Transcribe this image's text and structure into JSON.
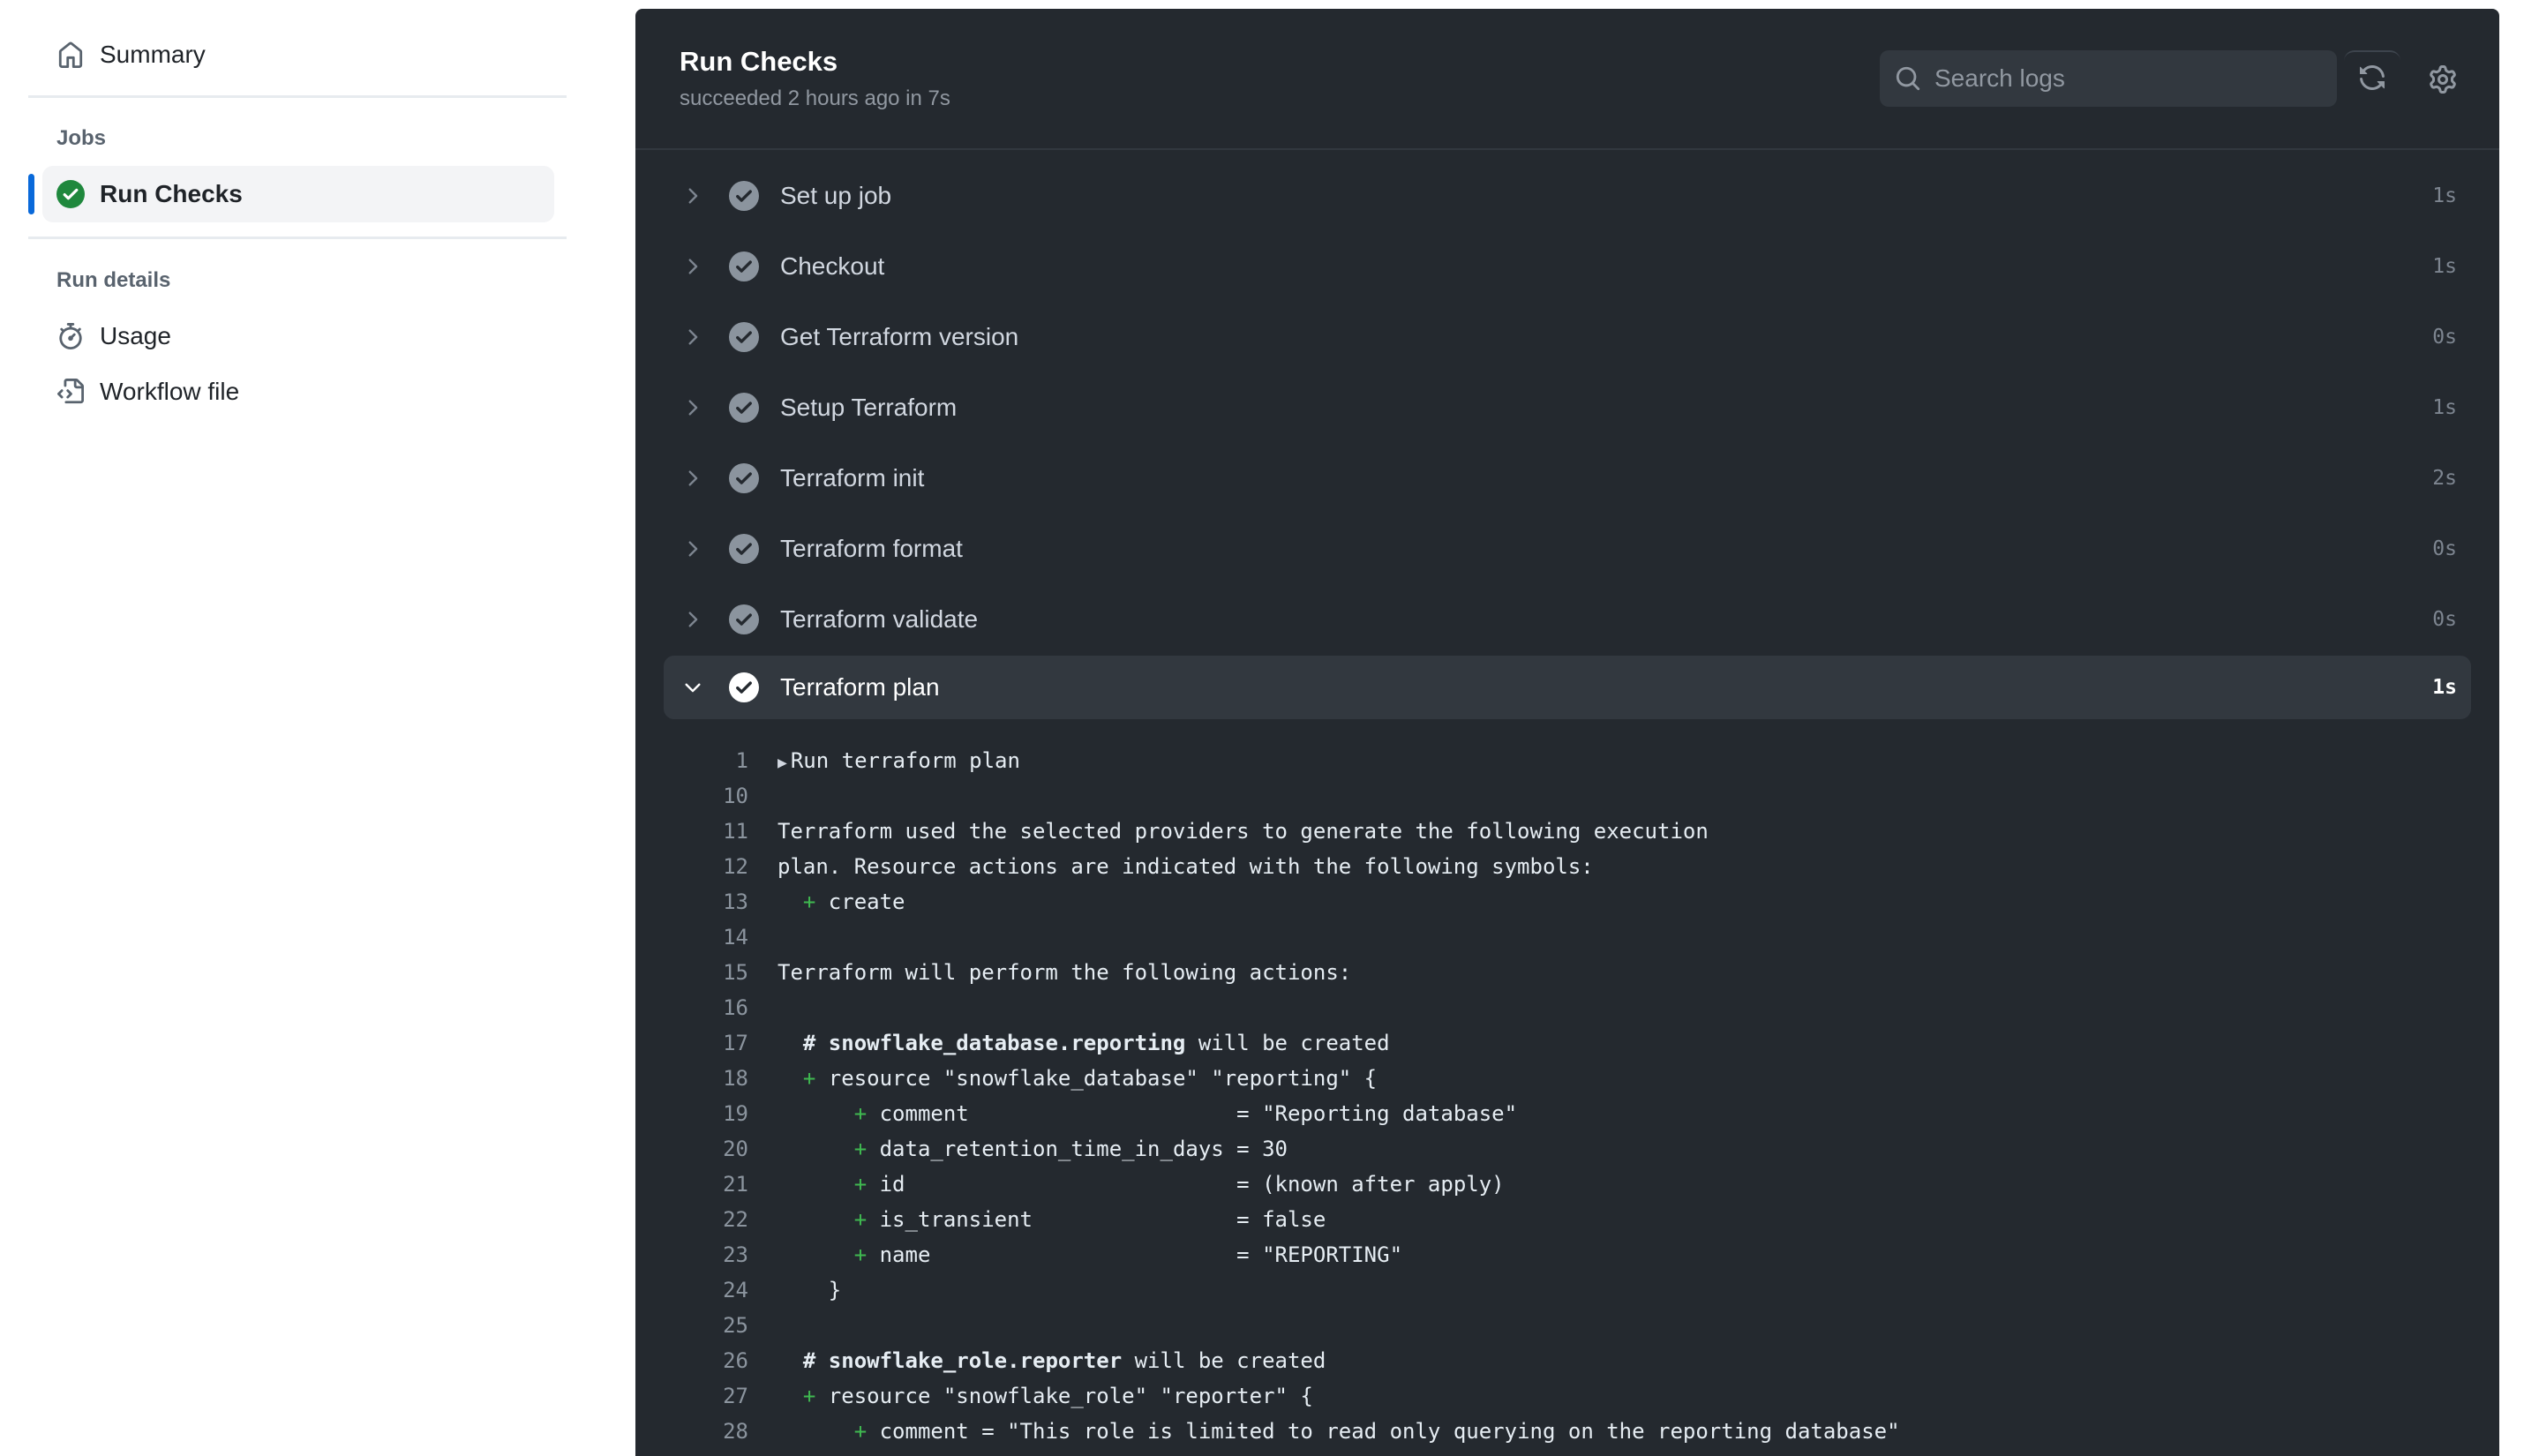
{
  "sidebar": {
    "summary_label": "Summary",
    "jobs_heading": "Jobs",
    "job_label": "Run Checks",
    "run_details_heading": "Run details",
    "usage_label": "Usage",
    "workflow_file_label": "Workflow file",
    "icons": {
      "summary": "home-icon",
      "job_status": "check-circle-fill-icon",
      "usage": "stopwatch-icon",
      "workflow_file": "file-code-icon"
    }
  },
  "header": {
    "title": "Run Checks",
    "subtitle": "succeeded 2 hours ago in 7s",
    "search_placeholder": "Search logs",
    "search_value": "",
    "refresh_icon": "sync-icon",
    "settings_icon": "gear-icon"
  },
  "steps": [
    {
      "name": "Set up job",
      "duration": "1s",
      "status": "success",
      "expanded": false
    },
    {
      "name": "Checkout",
      "duration": "1s",
      "status": "success",
      "expanded": false
    },
    {
      "name": "Get Terraform version",
      "duration": "0s",
      "status": "success",
      "expanded": false
    },
    {
      "name": "Setup Terraform",
      "duration": "1s",
      "status": "success",
      "expanded": false
    },
    {
      "name": "Terraform init",
      "duration": "2s",
      "status": "success",
      "expanded": false
    },
    {
      "name": "Terraform format",
      "duration": "0s",
      "status": "success",
      "expanded": false
    },
    {
      "name": "Terraform validate",
      "duration": "0s",
      "status": "success",
      "expanded": false
    },
    {
      "name": "Terraform plan",
      "duration": "1s",
      "status": "success",
      "expanded": true
    }
  ],
  "log": [
    {
      "n": "1",
      "segs": [
        {
          "t": "Run terraform plan",
          "k": "group"
        }
      ]
    },
    {
      "n": "10",
      "segs": []
    },
    {
      "n": "11",
      "segs": [
        {
          "t": "Terraform used the selected providers to generate the following execution"
        }
      ]
    },
    {
      "n": "12",
      "segs": [
        {
          "t": "plan. Resource actions are indicated with the following symbols:"
        }
      ]
    },
    {
      "n": "13",
      "segs": [
        {
          "t": "  "
        },
        {
          "t": "+",
          "k": "plus"
        },
        {
          "t": " create"
        }
      ]
    },
    {
      "n": "14",
      "segs": []
    },
    {
      "n": "15",
      "segs": [
        {
          "t": "Terraform will perform the following actions:"
        }
      ]
    },
    {
      "n": "16",
      "segs": []
    },
    {
      "n": "17",
      "segs": [
        {
          "t": "  "
        },
        {
          "t": "# snowflake_database.reporting",
          "k": "b"
        },
        {
          "t": " will be created"
        }
      ]
    },
    {
      "n": "18",
      "segs": [
        {
          "t": "  "
        },
        {
          "t": "+",
          "k": "plus"
        },
        {
          "t": " resource \"snowflake_database\" \"reporting\" {"
        }
      ]
    },
    {
      "n": "19",
      "segs": [
        {
          "t": "      "
        },
        {
          "t": "+",
          "k": "plus"
        },
        {
          "t": " comment                     = \"Reporting database\""
        }
      ]
    },
    {
      "n": "20",
      "segs": [
        {
          "t": "      "
        },
        {
          "t": "+",
          "k": "plus"
        },
        {
          "t": " data_retention_time_in_days = 30"
        }
      ]
    },
    {
      "n": "21",
      "segs": [
        {
          "t": "      "
        },
        {
          "t": "+",
          "k": "plus"
        },
        {
          "t": " id                          = (known after apply)"
        }
      ]
    },
    {
      "n": "22",
      "segs": [
        {
          "t": "      "
        },
        {
          "t": "+",
          "k": "plus"
        },
        {
          "t": " is_transient                = false"
        }
      ]
    },
    {
      "n": "23",
      "segs": [
        {
          "t": "      "
        },
        {
          "t": "+",
          "k": "plus"
        },
        {
          "t": " name                        = \"REPORTING\""
        }
      ]
    },
    {
      "n": "24",
      "segs": [
        {
          "t": "    }"
        }
      ]
    },
    {
      "n": "25",
      "segs": []
    },
    {
      "n": "26",
      "segs": [
        {
          "t": "  "
        },
        {
          "t": "# snowflake_role.reporter",
          "k": "b"
        },
        {
          "t": " will be created"
        }
      ]
    },
    {
      "n": "27",
      "segs": [
        {
          "t": "  "
        },
        {
          "t": "+",
          "k": "plus"
        },
        {
          "t": " resource \"snowflake_role\" \"reporter\" {"
        }
      ]
    },
    {
      "n": "28",
      "segs": [
        {
          "t": "      "
        },
        {
          "t": "+",
          "k": "plus"
        },
        {
          "t": " comment = \"This role is limited to read only querying on the reporting database\""
        }
      ]
    }
  ],
  "colors": {
    "accent": "#0969da",
    "success": "#1f883d",
    "panel_bg": "#24292f",
    "plus": "#3fb950"
  }
}
